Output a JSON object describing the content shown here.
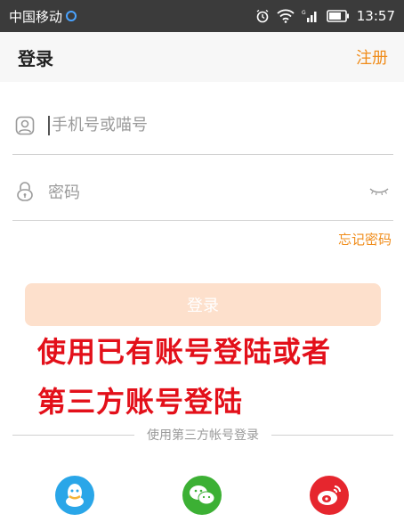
{
  "status_bar": {
    "carrier": "中国移动",
    "time": "13:57",
    "icons": [
      "alarm-icon",
      "wifi-icon",
      "signal-icon",
      "battery-icon"
    ]
  },
  "header": {
    "title": "登录",
    "register_label": "注册"
  },
  "form": {
    "account_placeholder": "手机号或喵号",
    "password_placeholder": "密码",
    "forgot_label": "忘记密码",
    "login_label": "登录"
  },
  "annotation": {
    "line1": "使用已有账号登陆或者",
    "line2": "第三方账号登陆"
  },
  "third_party": {
    "divider_text": "使用第三方帐号登录",
    "providers": [
      "qq-icon",
      "wechat-icon",
      "weibo-icon"
    ]
  },
  "colors": {
    "accent": "#f08c1a",
    "login_button_disabled": "#fde0cc",
    "annotation_red": "#e3101a",
    "qq_blue": "#2aa6e8",
    "wechat_green": "#3cb034",
    "weibo_red": "#e6262e"
  }
}
